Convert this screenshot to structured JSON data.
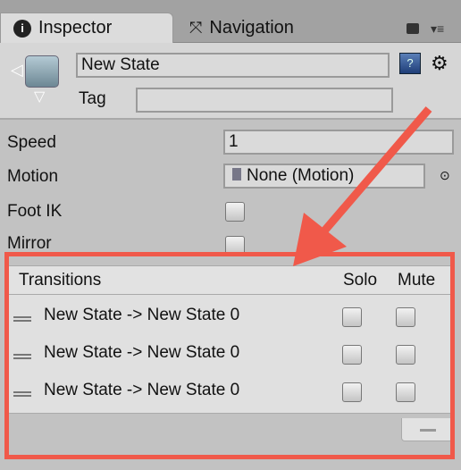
{
  "tabs": [
    {
      "label": "Inspector",
      "icon": "info-icon",
      "active": true
    },
    {
      "label": "Navigation",
      "icon": "navigation-icon",
      "active": false
    }
  ],
  "header": {
    "name": "New State",
    "tag_label": "Tag",
    "tag_value": ""
  },
  "properties": {
    "speed_label": "Speed",
    "speed_value": "1",
    "motion_label": "Motion",
    "motion_value": "None (Motion)",
    "foot_ik_label": "Foot IK",
    "foot_ik_checked": false,
    "mirror_label": "Mirror",
    "mirror_checked": false
  },
  "transitions": {
    "header": "Transitions",
    "solo_label": "Solo",
    "mute_label": "Mute",
    "items": [
      {
        "label": "New State -> New State 0",
        "solo": false,
        "mute": false
      },
      {
        "label": "New State -> New State 0",
        "solo": false,
        "mute": false
      },
      {
        "label": "New State -> New State 0",
        "solo": false,
        "mute": false
      }
    ]
  },
  "annotation_color": "#f0594a"
}
